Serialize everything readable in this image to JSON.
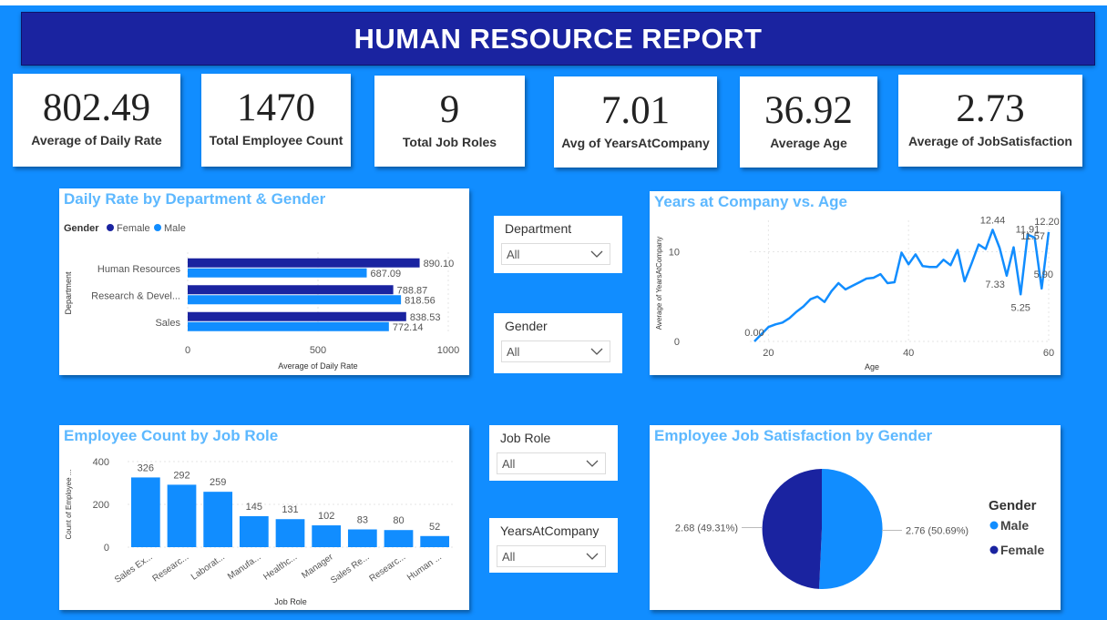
{
  "header": {
    "title": "HUMAN RESOURCE REPORT"
  },
  "kpis": [
    {
      "value": "802.49",
      "label": "Average of Daily Rate"
    },
    {
      "value": "1470",
      "label": "Total Employee Count"
    },
    {
      "value": "9",
      "label": "Total Job Roles"
    },
    {
      "value": "7.01",
      "label": "Avg of YearsAtCompany"
    },
    {
      "value": "36.92",
      "label": "Average Age"
    },
    {
      "value": "2.73",
      "label": "Average of JobSatisfaction"
    }
  ],
  "slicers": [
    {
      "label": "Department",
      "value": "All"
    },
    {
      "label": "Gender",
      "value": "All"
    },
    {
      "label": "Job Role",
      "value": "All"
    },
    {
      "label": "YearsAtCompany",
      "value": "All"
    }
  ],
  "colors": {
    "female": "#1A23A0",
    "male": "#118DFF",
    "title": "#5DB8FF",
    "background": "#118DFF"
  },
  "chart_data": [
    {
      "type": "bar",
      "orientation": "horizontal",
      "title": "Daily Rate by Department & Gender",
      "legend_title": "Gender",
      "legend_position": "top-left",
      "categories": [
        "Human Resources",
        "Research & Devel...",
        "Sales"
      ],
      "series": [
        {
          "name": "Female",
          "values": [
            890.1,
            788.87,
            838.53
          ],
          "labels": [
            "890.10",
            "788.87",
            "838.53"
          ]
        },
        {
          "name": "Male",
          "values": [
            687.09,
            818.56,
            772.14
          ],
          "labels": [
            "687.09",
            "818.56",
            "772.14"
          ]
        }
      ],
      "xlabel": "Average of Daily Rate",
      "ylabel": "Department",
      "xlim": [
        0,
        1000
      ],
      "xticks": [
        "0",
        "500",
        "1000"
      ]
    },
    {
      "type": "line",
      "title": "Years at Company vs. Age",
      "xlabel": "Age",
      "ylabel": "Average of YearsAtCompany",
      "xlim": [
        18,
        60
      ],
      "ylim": [
        0,
        13.5
      ],
      "xticks": [
        "20",
        "40",
        "60"
      ],
      "yticks": [
        "0",
        "10"
      ],
      "grid": true,
      "x": [
        18,
        19,
        20,
        21,
        22,
        23,
        24,
        25,
        26,
        27,
        28,
        29,
        30,
        31,
        32,
        33,
        34,
        35,
        36,
        37,
        38,
        39,
        40,
        41,
        42,
        43,
        44,
        45,
        46,
        47,
        48,
        49,
        50,
        51,
        52,
        53,
        54,
        55,
        56,
        57,
        58,
        59,
        60
      ],
      "y": [
        0.0,
        0.8,
        1.6,
        1.9,
        2.1,
        2.6,
        3.3,
        3.9,
        4.7,
        5.0,
        4.4,
        5.6,
        6.5,
        5.8,
        6.2,
        6.6,
        7.0,
        7.1,
        7.5,
        6.5,
        6.6,
        9.9,
        8.6,
        9.7,
        8.4,
        8.3,
        8.3,
        9.1,
        8.5,
        10.2,
        6.7,
        8.7,
        10.8,
        10.3,
        12.44,
        10.4,
        7.33,
        10.5,
        5.25,
        11.91,
        11.57,
        5.9,
        12.2
      ],
      "point_labels": [
        {
          "x": 18,
          "text": "0.00"
        },
        {
          "x": 52,
          "text": "12.44"
        },
        {
          "x": 54,
          "text": "7.33"
        },
        {
          "x": 56,
          "text": "5.25"
        },
        {
          "x": 57,
          "text": "11.91"
        },
        {
          "x": 58,
          "text": "11.57"
        },
        {
          "x": 59,
          "text": "5.90"
        },
        {
          "x": 60,
          "text": "12.20"
        }
      ]
    },
    {
      "type": "bar",
      "title": "Employee Count by Job Role",
      "categories": [
        "Sales Ex...",
        "Researc...",
        "Laborat...",
        "Manufa...",
        "Healthc...",
        "Manager",
        "Sales Re...",
        "Researc...",
        "Human ..."
      ],
      "values": [
        326,
        292,
        259,
        145,
        131,
        102,
        83,
        80,
        52
      ],
      "xlabel": "Job Role",
      "ylabel": "Count of Employee ...",
      "ylim": [
        0,
        430
      ],
      "yticks": [
        "0",
        "200",
        "400"
      ]
    },
    {
      "type": "pie",
      "title": "Employee Job Satisfaction by Gender",
      "legend_title": "Gender",
      "legend_position": "right",
      "slices": [
        {
          "name": "Male",
          "value": 2.76,
          "label": "2.76 (50.69%)"
        },
        {
          "name": "Female",
          "value": 2.68,
          "label": "2.68 (49.31%)"
        }
      ]
    }
  ]
}
